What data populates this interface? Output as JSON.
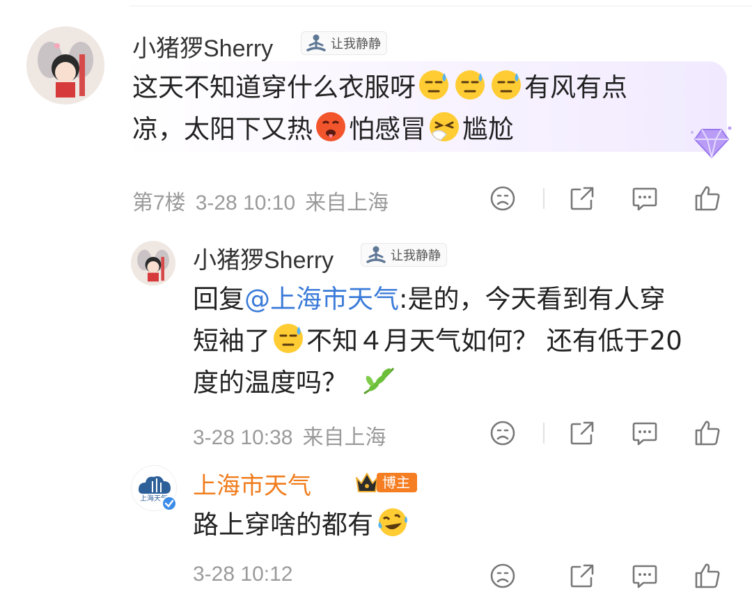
{
  "comments": [
    {
      "username": "小猪猡Sherry",
      "tag_label": "让我静静",
      "text_parts": {
        "l1a": "这天不知道穿什么衣服呀",
        "l1b": "有风有点",
        "l2a": "凉，太阳下又热",
        "l2b": "怕感冒",
        "l2c": "尴尬"
      },
      "floor": "第7楼",
      "time": "3-28 10:10",
      "location": "来自上海"
    }
  ],
  "replies": [
    {
      "username": "小猪猡Sherry",
      "tag_label": "让我静静",
      "text_parts": {
        "prefix": "回复",
        "mention": "@上海市天气",
        "l1": ":是的，今天看到有人穿",
        "l2a": "短袖了",
        "l2b": "不知４月天气如何？ 还有低于20",
        "l3": "度的温度吗？"
      },
      "time": "3-28 10:38",
      "location": "来自上海"
    },
    {
      "username": "上海市天气",
      "badge_label": "博主",
      "avatar_text": "上海天气",
      "text": "路上穿啥的都有",
      "time": "3-28 10:12"
    }
  ],
  "icons": [
    "meditation-icon",
    "sweat-emoji",
    "hot-face-emoji",
    "sneeze-emoji",
    "leaf-emoji",
    "laugh-cry-emoji",
    "dislike-face-icon",
    "share-icon",
    "reply-icon",
    "like-icon",
    "crown-icon",
    "verified-icon",
    "gem-icon"
  ],
  "colors": {
    "mention": "#3b7bd9",
    "brand": "#f07c1c",
    "meta": "#9a9a9a",
    "badge": "#f57d22"
  }
}
